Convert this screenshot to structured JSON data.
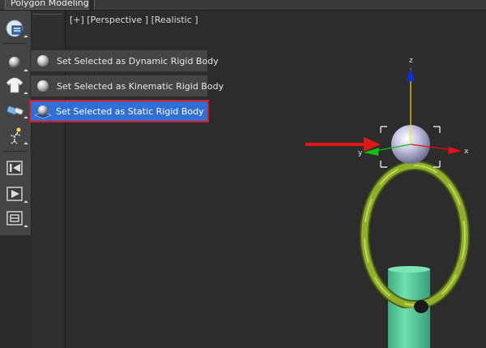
{
  "ribbon": {
    "active_tab": "Polygon Modeling"
  },
  "toolbar": {
    "buttons": [
      {
        "icon": "massfx-tools-icon"
      },
      {
        "icon": "rigid-body-icon"
      },
      {
        "icon": "cloth-icon"
      },
      {
        "icon": "constraint-icon"
      },
      {
        "icon": "ragdoll-icon"
      },
      {
        "icon": "reset-simulation-icon"
      },
      {
        "icon": "play-simulation-icon"
      },
      {
        "icon": "bake-simulation-icon"
      }
    ]
  },
  "viewport": {
    "label": "[+] [Perspective ] [Realistic ]"
  },
  "gizmo": {
    "z_axis_label": "z",
    "x_axis_label": "x",
    "y_axis_label": "y"
  },
  "flyout_menu": {
    "items": [
      {
        "label": "Set Selected as Dynamic Rigid Body",
        "selected": false
      },
      {
        "label": "Set Selected as Kinematic Rigid Body",
        "selected": false
      },
      {
        "label": "Set Selected as Static Rigid Body",
        "selected": true
      }
    ]
  },
  "colors": {
    "menu_highlight": "#2f6fd6",
    "highlight_border": "#e01818",
    "annotation_arrow": "#e01818",
    "ring": "#8fae2a",
    "cylinder": "#5fcf9d",
    "sphere": "#c8c8e6"
  }
}
